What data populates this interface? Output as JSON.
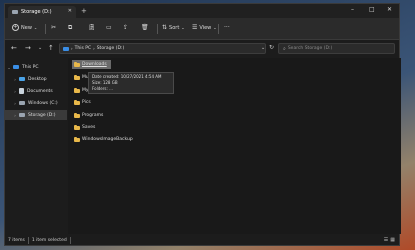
{
  "tab": {
    "title": "Storage (D:)"
  },
  "toolbar": {
    "new_label": "New",
    "sort_label": "Sort",
    "view_label": "View"
  },
  "address": {
    "items": [
      "This PC",
      "Storage (D:)"
    ]
  },
  "search": {
    "placeholder": "Search Storage (D:)"
  },
  "sidebar": {
    "items": [
      {
        "label": "This PC"
      },
      {
        "label": "Desktop"
      },
      {
        "label": "Documents"
      },
      {
        "label": "Windows (C:)"
      },
      {
        "label": "Storage (D:)"
      }
    ]
  },
  "files": [
    {
      "name": "Downloads"
    },
    {
      "name": "Music"
    },
    {
      "name": "My Stuff"
    },
    {
      "name": "Pics"
    },
    {
      "name": "Programs"
    },
    {
      "name": "Saves"
    },
    {
      "name": "WindowsImageBackup"
    }
  ],
  "tooltip": {
    "line1": "Date created: 10/27/2021 4:54 AM",
    "line2": "Size: 128 GB",
    "line3": "Folders: ..."
  },
  "status": {
    "items": "7 items",
    "selected": "1 item selected"
  }
}
